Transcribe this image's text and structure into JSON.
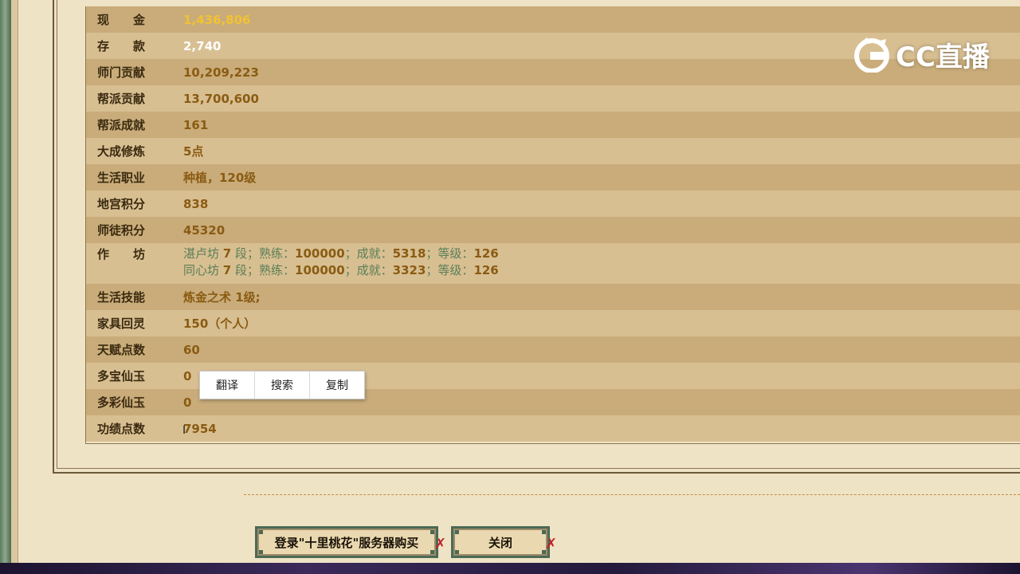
{
  "rows": [
    {
      "label": "现　　金",
      "value": "1,436,806",
      "style": "yellow"
    },
    {
      "label": "存　　款",
      "value": "2,740",
      "style": "white"
    },
    {
      "label": "师门贡献",
      "value": "10,209,223"
    },
    {
      "label": "帮派贡献",
      "value": "13,700,600"
    },
    {
      "label": "帮派成就",
      "value": "161"
    },
    {
      "label": "大成修炼",
      "value": "5点"
    },
    {
      "label": "生活职业",
      "value": "种植，120级"
    },
    {
      "label": "地宫积分",
      "value": "838"
    },
    {
      "label": "师徒积分",
      "value": "45320"
    }
  ],
  "workshop": {
    "label": "作　　坊",
    "lines": [
      {
        "name": "湛卢坊",
        "level": "7",
        "seg": "段；熟练：",
        "skill": "100000",
        "ach_lbl": "；成就：",
        "ach": "5318",
        "grade_lbl": "；等级：",
        "grade": "126"
      },
      {
        "name": "同心坊",
        "level": "7",
        "seg": "段；熟练：",
        "skill": "100000",
        "ach_lbl": "；成就：",
        "ach": "3323",
        "grade_lbl": "；等级：",
        "grade": "126"
      }
    ]
  },
  "rows2": [
    {
      "label": "生活技能",
      "value": "炼金之术 1级;"
    },
    {
      "label": "家具回灵",
      "value": "150（个人）"
    },
    {
      "label": "天赋点数",
      "value": "60"
    },
    {
      "label": "多宝仙玉",
      "value": "0"
    },
    {
      "label": "多彩仙玉",
      "value": "0"
    },
    {
      "label": "功绩点数",
      "value": "7954"
    }
  ],
  "context_menu": [
    "翻译",
    "搜索",
    "复制"
  ],
  "buttons": {
    "buy": "登录\"十里桃花\"服务器购买",
    "close": "关闭"
  },
  "watermark": "CC直播"
}
